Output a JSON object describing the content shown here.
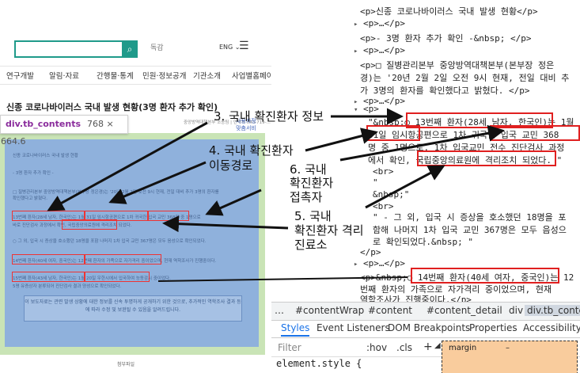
{
  "left": {
    "site_logo": "독감",
    "lang_toggle": "ENG",
    "nav": [
      "연구개발",
      "알림·자료",
      "간행물·통계",
      "민원·정보공개",
      "기관소개",
      "사업별홈페이지"
    ],
    "page_title": "신종 코로나바이러스 국내 발생 현황(3명 환자 추가 확인)",
    "page_meta": "중앙방역대책본부 조종팀  |  연락처 043-719-...",
    "side_float": "사용자정 맞춤서비",
    "tooltip": {
      "name": "div.tb_contents",
      "dims": "768 × 664.6"
    },
    "body_lines": [
      "신종 코로나바이러스 국내 발생 현황",
      "- 3명 환자 추가 확인 -",
      "□ 질병관리본부 중앙방역대책본부(본부장 정은경)는 '20년 2월 2일 오전 9시 현재, 전일 대비 추가 3명의 환자를",
      "확인했다고 밝혔다.",
      "13번째 환자(28세 남자, 한국인)는 1월 31일 임시항공편으로 1차 귀국한 입국 교민 368명 중 1명으로",
      "바로 진단검사 과정에서 확인, 국립중앙의료원에 격리조치 되었다.",
      "○ 그 외, 입국 시 증상을 호소했던 18명을 포함 나머지 1차 입국 교민 367명은 모두 음성으로 확인되었다.",
      "14번째 환자(40세 여자, 중국인)는 12번째 환자의 가족으로 자가격리 중이었으며, 현재 역학조사가 진행중이다.",
      "15번째 환자(43세 남자, 한국인)는 1월 20일 우한시에서 입국하여 능동감시 중이었다.",
      "5명 유증상자 분류되어 진단검사 결과 양성으로 확인되었다."
    ],
    "note": "이 보도자료는 관련 발생 상황에 대한 정보를 신속 투명하게 공개하기 위한 것으로, 추가적인 역학조사 결과 등에 따라 수정 및 보완될 수 있음을 알려드립니다.",
    "footer": "첨부파일"
  },
  "annotations": {
    "a3": "3. 국내 확진환자 정보",
    "a4_1": "4. 국내 확진환자",
    "a4_2": "이동경로",
    "a6_1": "6. 국내",
    "a6_2": "확진환자",
    "a6_3": "접촉자",
    "a5_1": "5. 국내",
    "a5_2": "확진환자 격리",
    "a5_3": "진료소"
  },
  "devtools": {
    "lines": [
      "<p>신종 코로나바이러스 국내 발생 현황</p>",
      "<p>…</p>",
      "<p>- 3명 환자 추가 확인 -&nbsp; </p>",
      "<p>…</p>",
      "<p>□ 질병관리본부 중앙방역대책본부(본부장 정은",
      "경)는 '20년 2월 2일 오전 9시 현재, 전일 대비 추",
      "가 3명의 환자를 확인했다고 밝혔다. </p>",
      "<p>…</p>",
      "<p>",
      "\"&nbsp;○ 13번째 환자(28세 남자, 한국인)는 1월",
      "31일 임시항공편으로 1차 귀국한 입국 교민 368",
      "명 중 1명으로, 1차 입국교민 전수 진단검사 과정",
      "에서 확인, 국립중앙의료원에 격리조치 되었다. \"",
      "<br>",
      "\"",
      "&nbsp;\"",
      "<br>",
      "\" - 그 외, 입국 시 증상을 호소했던 18명을 포",
      "함해 나머지 1차 입국 교민 367명은 모두 음성으",
      "로 확인되었다.&nbsp; \"",
      "</p>",
      "<p>…</p>",
      "<p>&nbsp;○ 14번째 환자(40세 여자, 중국인)는 12",
      "번째 환자의 가족으로 자가격리 중이었으며, 현재",
      "역학조사가 진행중이다.</p>"
    ],
    "crumbs": [
      "…",
      "#contentWrap",
      "#content",
      "#content_detail",
      "div",
      "div.tb_contents",
      "p"
    ],
    "tabs": [
      "Styles",
      "Event Listeners",
      "DOM Breakpoints",
      "Properties",
      "Accessibility"
    ],
    "filter_placeholder": "Filter",
    "hov": ":hov",
    "cls": ".cls",
    "plus": "+",
    "style_rule": "element.style {",
    "box_label": "margin",
    "box_value": "–"
  }
}
